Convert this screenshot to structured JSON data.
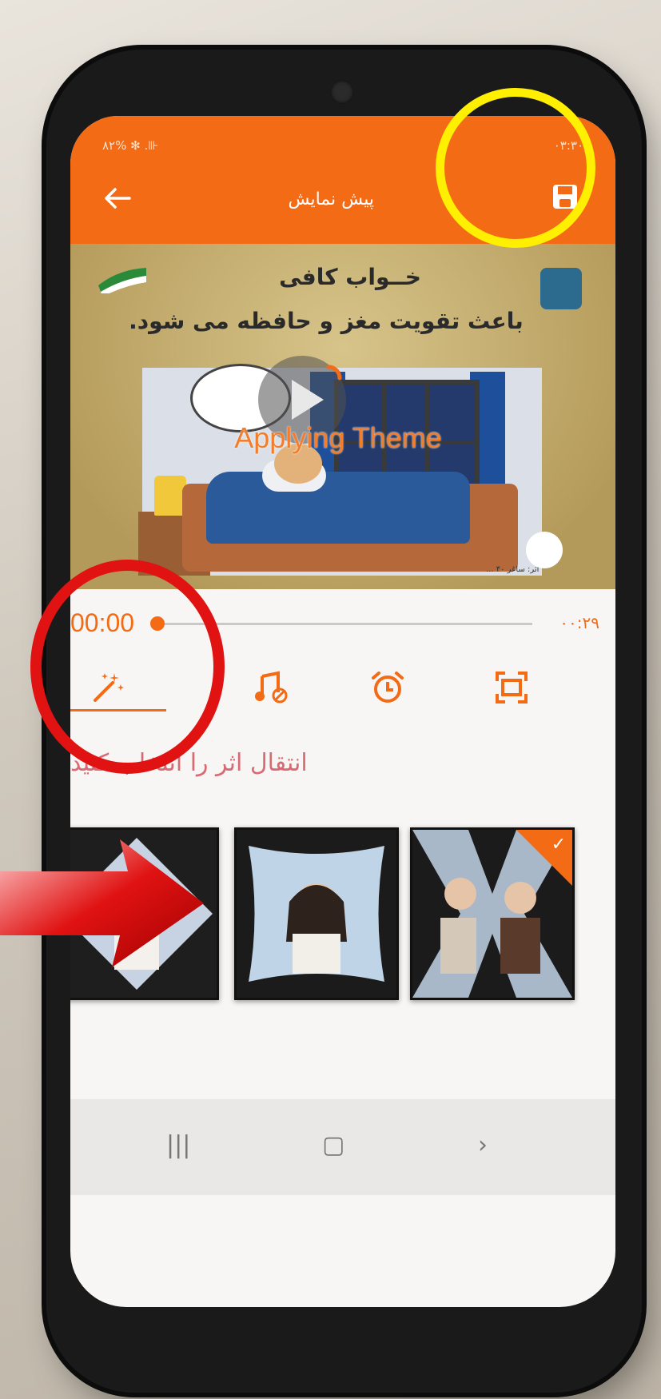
{
  "status_bar": {
    "left": "۸۲% ✻ .⊪",
    "right": "۰۳:۳۰"
  },
  "app_bar": {
    "title": "پیش نمایش"
  },
  "preview": {
    "headline": "خــواب کافی",
    "subline": "باعث تقویت مغز و حافظه می شود.",
    "overlay": "Applying Theme",
    "credit": "اثر: ساغر ۴۰ ..."
  },
  "timeline": {
    "start": "00:00",
    "end": "۰۰:۲۹",
    "progress": 0
  },
  "tabs": [
    {
      "name": "transition",
      "icon": "magic-wand-icon",
      "active": true
    },
    {
      "name": "music",
      "icon": "music-note-icon",
      "active": false
    },
    {
      "name": "duration",
      "icon": "alarm-clock-icon",
      "active": false
    },
    {
      "name": "ratio",
      "icon": "crop-frame-icon",
      "active": false
    }
  ],
  "hint": "انتقال اثر را انتخاب کنید",
  "transitions": [
    {
      "name": "diamond",
      "selected": false
    },
    {
      "name": "curved-frame",
      "selected": false
    },
    {
      "name": "x-split",
      "selected": true
    }
  ],
  "colors": {
    "accent": "#f36b14",
    "hint": "#d96a73",
    "annotation_yellow": "#ffef00",
    "annotation_red": "#e01212"
  }
}
